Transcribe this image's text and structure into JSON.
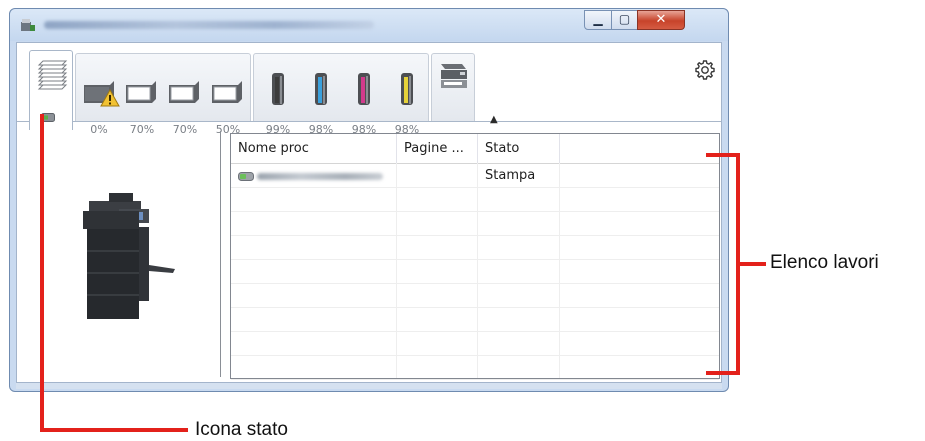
{
  "window": {
    "title_obscured": true
  },
  "toolbar": {
    "trays": [
      {
        "name": "tray-bypass",
        "level": "0%",
        "warning": true
      },
      {
        "name": "tray-1",
        "level": "70%"
      },
      {
        "name": "tray-2",
        "level": "70%"
      },
      {
        "name": "tray-3",
        "level": "50%"
      }
    ],
    "toners": [
      {
        "name": "toner-black",
        "level": "99%",
        "color": "#3c3c3c"
      },
      {
        "name": "toner-cyan",
        "level": "98%",
        "color": "#3aa0dc"
      },
      {
        "name": "toner-magenta",
        "level": "98%",
        "color": "#d23a8c"
      },
      {
        "name": "toner-yellow",
        "level": "98%",
        "color": "#e6d23a"
      }
    ],
    "collapse_glyph": "▲"
  },
  "job_list": {
    "columns": [
      "Nome proc",
      "Pagine ...",
      "Stato"
    ],
    "rows": [
      {
        "name_obscured": true,
        "pages": "",
        "status": "Stampa"
      }
    ],
    "empty_rows": 8
  },
  "callouts": {
    "job_list": "Elenco lavori",
    "status_icon": "Icona stato"
  },
  "colors": {
    "callout": "#e3211b",
    "window_frame": "#c9daf0",
    "close_button": "#c7432a"
  }
}
